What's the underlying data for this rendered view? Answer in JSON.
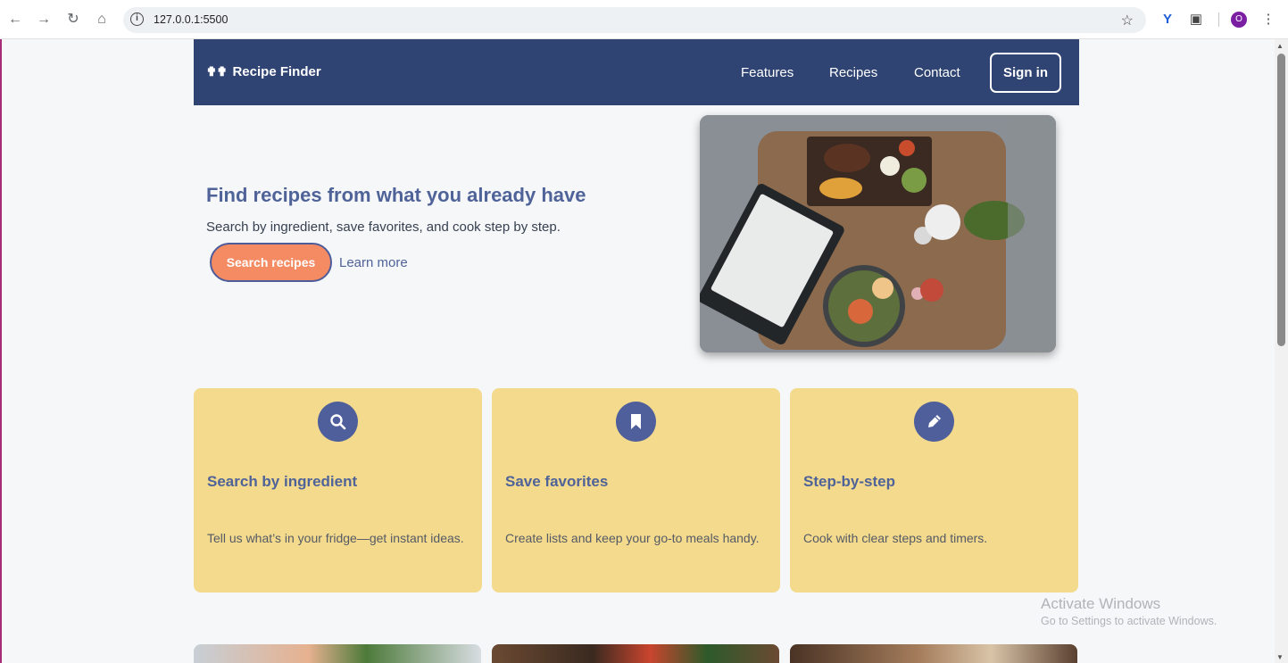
{
  "browser": {
    "url": "127.0.0.1:5500",
    "profile_initial": "O"
  },
  "nav": {
    "brand": "Recipe Finder",
    "links": [
      "Features",
      "Recipes",
      "Contact"
    ],
    "signin": "Sign in"
  },
  "hero": {
    "title": "Find recipes from what you already have",
    "subtitle": "Search by ingredient, save favorites, and cook step by step.",
    "primary_button": "Search recipes",
    "secondary_link": "Learn more"
  },
  "features": [
    {
      "icon": "search-icon",
      "title": "Search by ingredient",
      "text": "Tell us what’s in your fridge—get instant ideas."
    },
    {
      "icon": "bookmark-icon",
      "title": "Save favorites",
      "text": "Create lists and keep your go-to meals handy."
    },
    {
      "icon": "pencil-icon",
      "title": "Step-by-step",
      "text": "Cook with clear steps and timers."
    }
  ],
  "watermark": {
    "title": "Activate Windows",
    "subtitle": "Go to Settings to activate Windows."
  },
  "colors": {
    "nav_bg": "#2f4473",
    "accent": "#4f6399",
    "card_bg": "#f3da8c",
    "primary_button": "#f48b63",
    "page_bg": "#f6f7f9"
  }
}
